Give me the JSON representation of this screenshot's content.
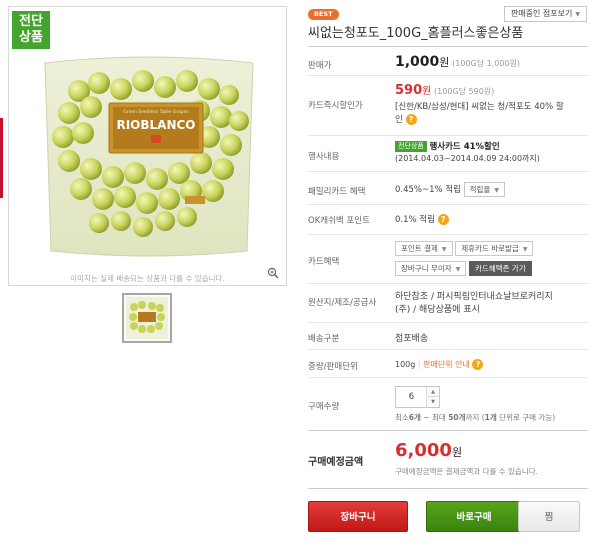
{
  "image": {
    "exclusive_badge": "전단상품",
    "package_brand": "RIOBLANCO",
    "package_top_text": "Green Seedless Table Grapes",
    "notice": "이미지는 실제 배송되는 상품과 다를 수 있습니다."
  },
  "header": {
    "best_badge": "BEST",
    "other_shops_button": "판매중인 점포보기",
    "title": "씨없는청포도_100G_홈플러스좋은상품"
  },
  "rows": {
    "price": {
      "label": "판매가",
      "value": "1,000",
      "unit": "원",
      "sub": "(100G당 1,000원)"
    },
    "card_discount": {
      "label": "카드즉시할인가",
      "value": "590",
      "unit": "원",
      "sub": "(100G당 590원)",
      "desc": "[신한/KB/삼성/현대] 씨없는 청/적포도 40% 할인"
    },
    "event": {
      "label": "행사내용",
      "tag": "전단상품",
      "title": "행사카드 41%할인",
      "period": "(2014.04.03~2014.04.09 24:00까지)"
    },
    "family_card": {
      "label": "패밀리카드 혜택",
      "value": "0.45%~1% 적립",
      "select": "적립율"
    },
    "ok_cashbag": {
      "label": "OK캐쉬백 포인트",
      "value": "0.1% 적립"
    },
    "card_benefit": {
      "label": "카드혜택",
      "select1": "포인트 결제",
      "select2": "제휴카드 바로발급",
      "select3": "장바구니 무이자",
      "button": "카드혜택존 가기"
    },
    "origin": {
      "label": "원산지/제조/공급사",
      "value_line1": "하단참조 / 퍼시픽림인터내쇼날브로커리지",
      "value_line2": "(주) / 해당상품에 표시"
    },
    "delivery": {
      "label": "배송구분",
      "value": "점포배송"
    },
    "weight": {
      "label": "중량/판매단위",
      "value": "100g",
      "sep": "|",
      "link": "판매단위 안내"
    },
    "quantity": {
      "label": "구매수량",
      "value": "6",
      "note_prefix": "최소",
      "min": "6개",
      "note_mid": "~ 최대",
      "max": "50개",
      "note_mid2": "까지 (",
      "unit": "1개",
      "note_suffix": "단위로 구매 가능)"
    }
  },
  "total": {
    "label": "구매예정금액",
    "value": "6,000",
    "unit": "원",
    "note": "구매예정금액은 결제금액과 다를 수 있습니다."
  },
  "buttons": {
    "cart": "장바구니",
    "buy": "바로구매",
    "wish": "찜"
  },
  "colors": {
    "accent_red": "#d6302e",
    "accent_green": "#43a52e",
    "badge_orange": "#e8702e"
  }
}
